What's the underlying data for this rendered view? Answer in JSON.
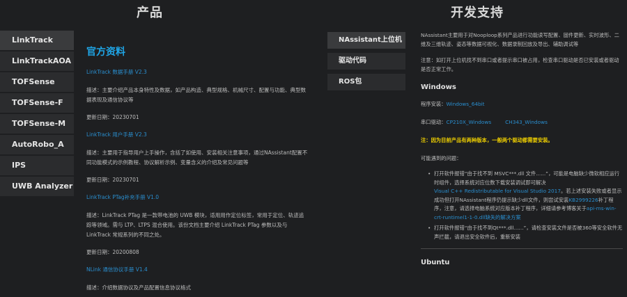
{
  "headers": {
    "products": "产品",
    "dev_support": "开发支持"
  },
  "sidebar": {
    "items": [
      {
        "label": "LinkTrack"
      },
      {
        "label": "LinkTrackAOA"
      },
      {
        "label": "TOFSense"
      },
      {
        "label": "TOFSense-F"
      },
      {
        "label": "TOFSense-M"
      },
      {
        "label": "AutoRobo_A"
      },
      {
        "label": "IPS"
      },
      {
        "label": "UWB Analyzer"
      }
    ]
  },
  "docs": {
    "heading": "官方资料",
    "items": [
      {
        "title": "LinkTrack 数据手册 V2.3",
        "desc": "描述：主要介绍产品本身特性及数据，如产品构造、典型规格、机械尺寸、配置与功能、典型数据表现及通信协议等",
        "date": "更新日期：20230701"
      },
      {
        "title": "LinkTrack 用户手册 V2.3",
        "desc": "描述：主要用于指导用户上手操作，含括了如使用、安装相关注意事项，通过NAssistant配置不同功能模式的示例教程、协议解析示例、变量含义的介绍及常见问题等",
        "date": "更新日期：20230701"
      },
      {
        "title": "LinkTrack PTag补充手册 V1.0",
        "desc": "描述：LinkTrack PTag 是一款带电池的 UWB 模块，适用用作定位标签，常用于定位、轨迹追踪等领域。需与 LTP、LTPS 混合使用。该份文档主要介绍 LinkTrack PTag 参数以及与 LinkTrack 常规系列的不同之处。",
        "date": "更新日期：20200808"
      },
      {
        "title": "NLink 通信协议手册 V1.4",
        "desc": "描述：介绍数据协议及产品配置信息协议格式",
        "date": ""
      }
    ]
  },
  "devnav": {
    "items": [
      {
        "label": "NAssistant上位机"
      },
      {
        "label": "驱动代码"
      },
      {
        "label": "ROS包"
      }
    ]
  },
  "dev": {
    "intro": "NAssistant主要用于对Nooploop系列产品进行功能读写配置、固件更新、实时波形、二维及三维轨迹、姿态等数据可视化、数据录制回放及导出、辅助调试等",
    "note": "注意：如打开上位机找不到串口或者提示串口被占用，检查串口驱动是否已安装或者驱动是否正常工作。",
    "windows_title": "Windows",
    "install_label": "程序安装：",
    "install_link": "Windows_64bit",
    "driver_label": "串口驱动：",
    "driver_link1": "CP210X_Windows",
    "driver_link2": "CH343_Windows",
    "warning": "注：因为目前产品有两种版本，一般两个驱动都需要安装。",
    "problems_title": "可能遇到的问题：",
    "q1_a": "打开软件报错“由于找不到 MSVC***.dll 文件......”，可能是电脑缺少微软相应运行时组件，选择系统对应位数下载安装调试即可解决",
    "q1_link": "Visual C++ Redistributable for Visual Studio 2017",
    "q1_b": "。若上述安装失败或者显示成功但打开NAssistant程序仍提示缺少dll文件，则尝试安装",
    "q1_kb": "KB2999226",
    "q1_c": "补丁程序，注意，请选择电脑系统对应版本补丁程序，详细请参考博客关于",
    "q1_link2": "api-ms-win-crt-runtimel1-1-0.dll缺失的解决方案",
    "q2": "打开软件报错“由于找不到Qt***.dll......”，请检查安装文件是否被360等安全软件无声拦截，请退出安全软件后，重新安装",
    "ubuntu_title": "Ubuntu"
  }
}
